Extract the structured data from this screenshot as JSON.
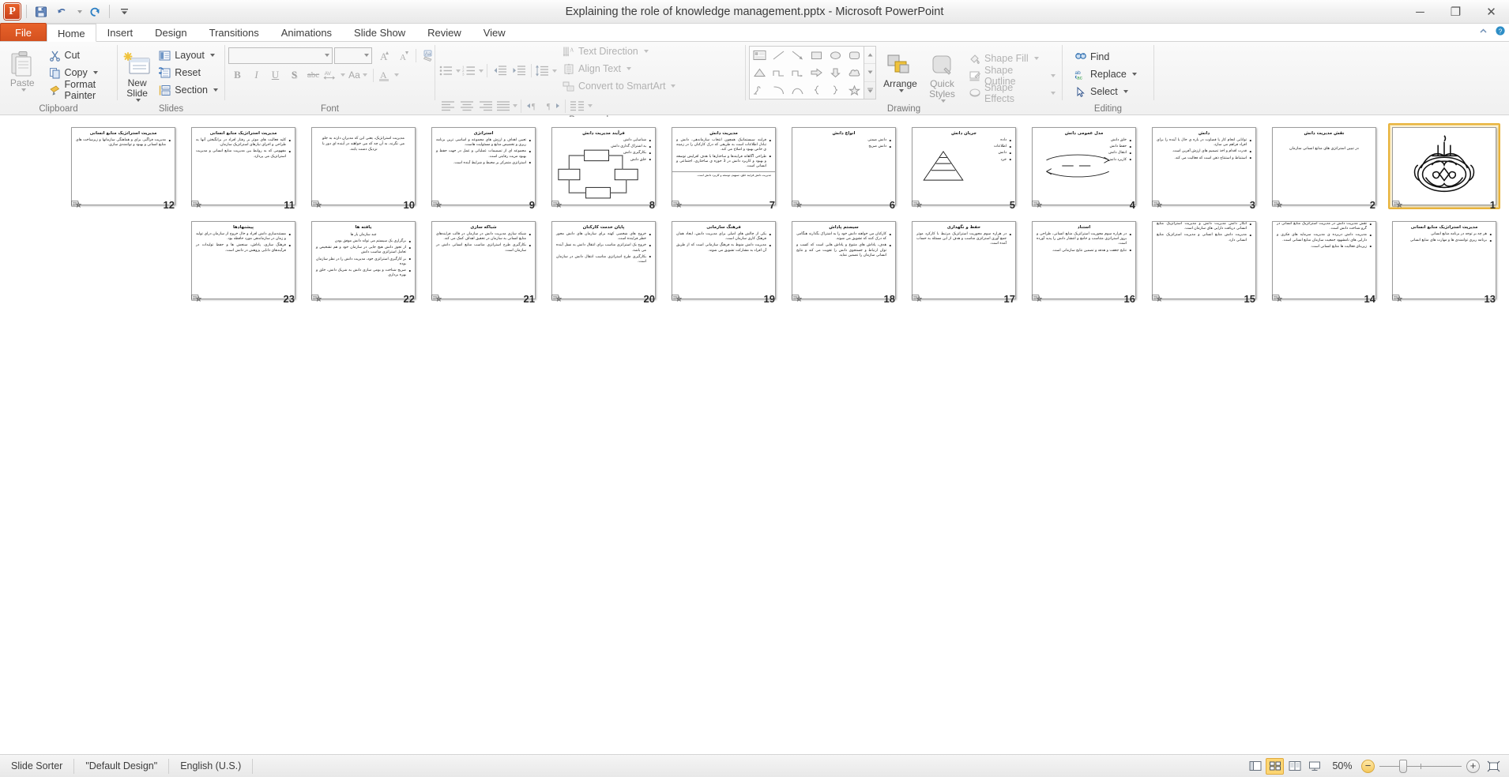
{
  "window": {
    "title": "Explaining the role of knowledge management.pptx  -  Microsoft PowerPoint",
    "minimize": "─",
    "restore": "❐",
    "close": "✕"
  },
  "quick_access": {
    "logo": "P",
    "save": "save-icon",
    "undo": "undo-icon",
    "redo": "redo-icon",
    "customize": "customize-qat-icon"
  },
  "tabs": [
    {
      "label": "File",
      "active": false,
      "file": true
    },
    {
      "label": "Home",
      "active": true
    },
    {
      "label": "Insert",
      "active": false
    },
    {
      "label": "Design",
      "active": false
    },
    {
      "label": "Transitions",
      "active": false
    },
    {
      "label": "Animations",
      "active": false
    },
    {
      "label": "Slide Show",
      "active": false
    },
    {
      "label": "Review",
      "active": false
    },
    {
      "label": "View",
      "active": false
    }
  ],
  "ribbon": {
    "clipboard": {
      "label": "Clipboard",
      "paste": "Paste",
      "cut": "Cut",
      "copy": "Copy",
      "format_painter": "Format Painter"
    },
    "slides": {
      "label": "Slides",
      "new_slide": "New Slide",
      "layout": "Layout",
      "reset": "Reset",
      "section": "Section"
    },
    "font": {
      "label": "Font",
      "font_name": "",
      "font_name_placeholder": "",
      "font_size": "",
      "grow": "grow-font-icon",
      "shrink": "shrink-font-icon",
      "clear_formatting": "clear-formatting-icon",
      "bold": "B",
      "italic": "I",
      "underline": "U",
      "shadow": "S",
      "strikethrough": "abc",
      "character_spacing": "AV",
      "change_case": "Aa",
      "font_color": "A"
    },
    "paragraph": {
      "label": "Paragraph",
      "bullets": "bullets-icon",
      "numbering": "numbering-icon",
      "decrease_indent": "decrease-indent-icon",
      "increase_indent": "increase-indent-icon",
      "line_spacing": "line-spacing-icon",
      "text_direction": "Text Direction",
      "align_text": "Align Text",
      "convert_smartart": "Convert to SmartArt",
      "align_left": "align-left-icon",
      "align_center": "align-center-icon",
      "align_right": "align-right-icon",
      "justify": "justify-icon",
      "ltr": "left-to-right-icon",
      "rtl": "right-to-left-icon",
      "columns": "columns-icon"
    },
    "drawing": {
      "label": "Drawing",
      "arrange": "Arrange",
      "quick_styles": "Quick Styles",
      "shape_fill": "Shape Fill",
      "shape_outline": "Shape Outline",
      "shape_effects": "Shape Effects",
      "shapes": [
        "textbox-shape",
        "line-shape",
        "arrow-shape",
        "rectangle-shape",
        "oval-shape",
        "rounded-rectangle-shape",
        "triangle-shape",
        "elbow-connector-shape",
        "elbow-arrow-connector-shape",
        "right-arrow-shape",
        "down-arrow-shape",
        "cloud-shape",
        "freeform-shape",
        "arc-shape",
        "curve-shape",
        "left-brace-shape",
        "right-brace-shape",
        "star-shape"
      ]
    },
    "editing": {
      "label": "Editing",
      "find": "Find",
      "replace": "Replace",
      "select": "Select"
    }
  },
  "status_bar": {
    "view_name": "Slide Sorter",
    "theme": "\"Default Design\"",
    "language": "English (U.S.)",
    "zoom_level": "50%",
    "zoom_out": "−",
    "zoom_in": "+",
    "views": [
      {
        "name": "normal-view-button",
        "active": false
      },
      {
        "name": "slide-sorter-view-button",
        "active": true
      },
      {
        "name": "reading-view-button",
        "active": false
      },
      {
        "name": "slide-show-button",
        "active": false
      }
    ],
    "fit_to_window": "fit-slide-to-window-button"
  },
  "slides": [
    {
      "number": "1",
      "type": "calligraphy",
      "title": "",
      "body": [],
      "selected": true
    },
    {
      "number": "2",
      "type": "center",
      "title": "نقش مدیریت دانش",
      "center_text": "در تبیین استراتژی های منابع انسانی سازمان",
      "body": [],
      "selected": false
    },
    {
      "number": "3",
      "type": "bullets",
      "title": "دانش",
      "body": [
        "توانایی انجام کار یا قضاوت در باره ی حال یا آینده را برای افراد فراهم می سازد.",
        "قدرت اقدام و اخذ تصمیم های ارزش آفرین است.",
        "استنباط و استنتاج ذهن است که فعالیت می کند."
      ],
      "selected": false
    },
    {
      "number": "4",
      "type": "bullets",
      "title": "مدل عمومی دانش",
      "body": [
        "خلق دانش",
        "حفظ دانش",
        "انتقال دانش",
        "کاربرد دانش"
      ],
      "has_diagram": true,
      "selected": false
    },
    {
      "number": "5",
      "type": "bullets",
      "title": "جریان دانش",
      "body": [
        "داده",
        "اطلاعات",
        "دانش",
        "خرد"
      ],
      "has_pyramid": true,
      "selected": false
    },
    {
      "number": "6",
      "type": "bullets",
      "title": "انواع دانش",
      "body": [
        "دانش ضمنی",
        "دانش صریح"
      ],
      "selected": false
    },
    {
      "number": "7",
      "type": "bullets",
      "title": "مدیریت دانش",
      "body": [
        "فرایند سیستماتیک همچون انتخاب سازماندهی، دانش و تبادل اطلاعات است به طریقی که درک کارکنان را در زمینه ی خاص بهبود و اصلاح می کند.",
        "طراحی آگاهانه فرایندها و ساختارها با هدف افزایش توسعه و بهبود و کاربرد دانش در 3 حوزه ی ساختاری، اجتماعی و انسانی است."
      ],
      "footnote": "مدیریت دانش فرایند خلق، تسهیم، توسعه و کاربرد دانش است.",
      "selected": false
    },
    {
      "number": "8",
      "type": "diagram",
      "title": "فرآیند مدیریت دانش",
      "body": [
        "شناسایی دانش",
        "به اشتراک گذاری دانش",
        "بکارگیری دانش",
        "خلق دانش"
      ],
      "selected": false
    },
    {
      "number": "9",
      "type": "bullets",
      "title": "استراتژی",
      "body": [
        "تعیین اهداف و ارزش های مجموعه و اساسی ترین برنامه ریزی و تخصیص منابع و مسئولیت هاست.",
        "مجموعه ای از تصمیمات عملیاتی و عمل در جهت حفظ و بهبود مزیت رقابتی است.",
        "استراتژی متمرکز بر محیط و شرایط آینده است."
      ],
      "selected": false
    },
    {
      "number": "10",
      "type": "center",
      "title": "",
      "center_text": "مدیریت استراتژیک، یعنی این که مدیران دارند به جلو می نگرند، به آن چه که می خواهند در آینده ای دور یا نزدیک دست یابند.",
      "body": [],
      "selected": false
    },
    {
      "number": "11",
      "type": "bullets",
      "title": "مدیریت استراتژیک منابع انسانی",
      "body": [
        "کلیه فعالیت های موثر بر رفتار افراد در برانگیختن آنها به طراحی و اجرای نیازهای استراتژیک سازمان.",
        "مفهومی که به روابط بین مدیریت منابع انسانی و مدیریت استراتژیک می پردازد."
      ],
      "selected": false
    },
    {
      "number": "12",
      "type": "bullets",
      "title": "مدیریت استراتژیک منابع انسانی",
      "body": [
        "مدیریت فراگیر، برای و هماهنگی سازمانها و زیرساخت های منابع انسانی و بهبود و توانمندی سازی."
      ],
      "selected": false
    },
    {
      "number": "13",
      "type": "bullets",
      "title": "مدیریت استراتژیک منابع انسانی",
      "body": [
        "هر چه بر توجه در برنامه منابع انسانی",
        "برنامه ریزی توانمندی ها و مهارت های منابع انسانی"
      ],
      "selected": false
    },
    {
      "number": "14",
      "type": "bullets",
      "title": "",
      "body": [
        "نقش مدیریت دانش در مدیریت استراتژیک منابع انسانی در گرو شناخت دانش است.",
        "مدیریت دانش دربرده ی مدیریت سرمایه های فکری و دارایی های نامشهود جمعیت سازمان منابع انسانی است.",
        "زیربنای فعالیت ها منابع انسانی است."
      ],
      "selected": false
    },
    {
      "number": "15",
      "type": "bullets",
      "title": "",
      "body": [
        "انگار دانش مدیریت دانش و مدیریت استراتژیک منابع انسانی دریافت دارایی های سازمان است.",
        "مدیریت دانش منابع انسانی و مدیریت استراتژیک منابع انسانی دارد."
      ],
      "selected": false
    },
    {
      "number": "16",
      "type": "bullets",
      "title": "استناد",
      "body": [
        "در هزاره سوم محوریت استراتژیک منابع انسانی، طراحی و بروز استراتژی متناسب و جامع و انتشار دانش را پدید آورده است.",
        "نتایج جعفت و هدفه و تضمین نتایج سازمانی است."
      ],
      "selected": false
    },
    {
      "number": "17",
      "type": "bullets",
      "title": "حفظ و نگهداری",
      "body": [
        "در هزاره سوم محوریت استراتژیک مرتبط با کارکرد موثر جمع آوری استراتژی مناسب و هدف از این مسئله به حساب آمده است."
      ],
      "selected": false
    },
    {
      "number": "18",
      "type": "bullets",
      "title": "سیستم پاداش",
      "body": [
        "کارکنان می خواهند دانش خود را به اشتراک بگذارند هنگامی که درک کنند که تشویق می شوند.",
        "هدف، پاداش های متنوع و پاداش هایی است که کسب و توان ارتباط و جستجوی دانش را تقویت می کند و نتایج انسانی سازمان را تضمین نماید."
      ],
      "selected": false
    },
    {
      "number": "19",
      "type": "bullets",
      "title": "فرهنگ سازمانی",
      "body": [
        "یکی از چالش های اصلی برای مدیریت دانش، ایجاد همان فرهنگ کاری سازمان است.",
        "مدیریت دانش منوط به فرهنگ سازمانی است که از طریق آن افراد به مشارکت تشویق می شوند."
      ],
      "selected": false
    },
    {
      "number": "20",
      "type": "bullets",
      "title": "پایان خدمت کارکنان",
      "body": [
        "خروج های شخصی کهنه برای سازمان های دانش محور خطر فزاینده است.",
        "خروج یک استراتژی مناسب برای انتقال دانش به نسل آینده می باشد.",
        "بکارگیری طرح استراتژی مناسب انتقال دانش در سازمان است."
      ],
      "selected": false
    },
    {
      "number": "21",
      "type": "bullets",
      "title": "شباکه سازی",
      "body": [
        "شبکه سازی مدیریت دانش در سازمان در قالب فرایندهای منابع انسانی به سازمان در تحقیق اهداف کمک می کند.",
        "بکارگیری طرح استراتژی مناسب منابع انسانی دانش در سازمان است."
      ],
      "selected": false
    },
    {
      "number": "22",
      "type": "bullets",
      "title": "یافته ها",
      "subtitle": "چند سازمان یار ها",
      "body": [
        "برگزاری یک سیستم می تواند دانش موفق بودن",
        "از تجوز دانش هیچ جایی در سازمان خود و هم تشخیص و تعامل استراتژی مناسب دانش",
        "بر کارگیری استراتژی خود، مدیریت دانش را در نظر سازمان بوده",
        "صریح شناخت و بومی سازی دانش به شریک دانش، خلق و بهره برداری"
      ],
      "selected": false
    },
    {
      "number": "23",
      "type": "bullets",
      "title": "پیشنهادها",
      "body": [
        "مستندسازی دانش افراد و حال خروج از سازمان درای تولید و زمان در سازماندهی مورد حافظه بود.",
        "فرهنگ سازی، پاداش، سنجش ها و حفظ تولیدات در فرآیندهای دانایی پژوهش در دانش است."
      ],
      "selected": false
    }
  ]
}
